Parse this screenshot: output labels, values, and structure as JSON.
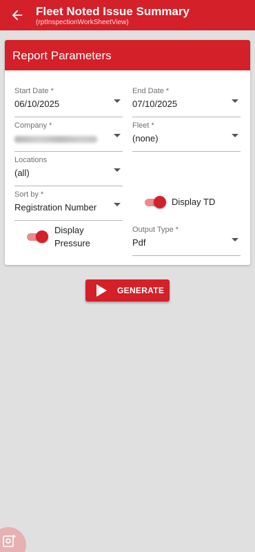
{
  "header": {
    "title": "Fleet Noted Issue Summary",
    "subtitle": "(rptInspectionWorkSheetView)"
  },
  "card": {
    "title": "Report Parameters"
  },
  "fields": {
    "start_date": {
      "label": "Start Date *",
      "value": "06/10/2025"
    },
    "end_date": {
      "label": "End Date *",
      "value": "07/10/2025"
    },
    "company": {
      "label": "Company *"
    },
    "fleet": {
      "label": "Fleet *",
      "value": "(none)"
    },
    "locations": {
      "label": "Locations",
      "value": "(all)"
    },
    "sort_by": {
      "label": "Sort by *",
      "value": "Registration Number"
    },
    "output_type": {
      "label": "Output Type *",
      "value": "Pdf"
    }
  },
  "toggles": {
    "display_td": {
      "label": "Display TD",
      "on": true
    },
    "display_pressure": {
      "label_line1": "Display",
      "label_line2": "Pressure",
      "on": true
    }
  },
  "generate_button": {
    "label": "GENERATE"
  },
  "colors": {
    "primary": "#d32029",
    "background": "#e0e0e0",
    "toggle_track": "#ec8a8e"
  },
  "icons": {
    "back": "arrow-left-icon",
    "dropdown": "caret-down-icon",
    "generate": "play-icon",
    "fab": "camera-doc-icon"
  }
}
